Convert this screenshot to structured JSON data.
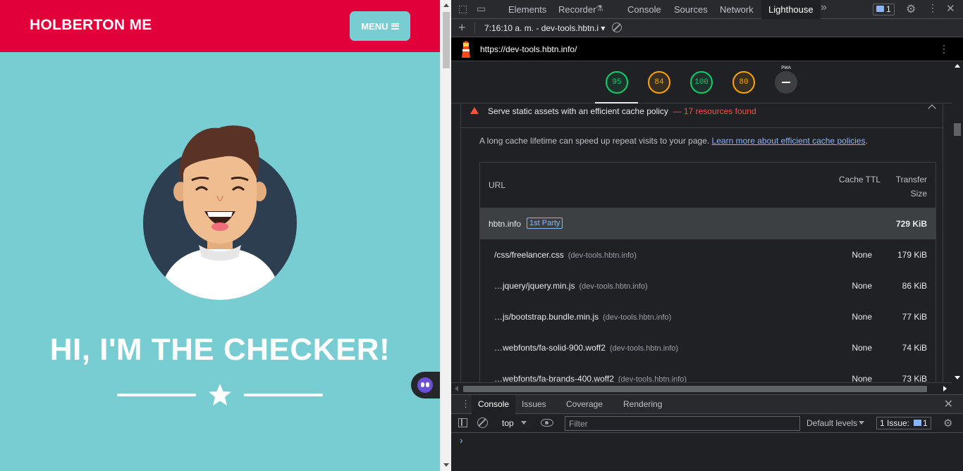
{
  "page": {
    "brand": "HOLBERTON ME",
    "menu_label": "MENU",
    "hero_title": "HI, I'M THE CHECKER!"
  },
  "devtools": {
    "tabs": [
      "Elements",
      "Recorder",
      "Console",
      "Sources",
      "Network",
      "Lighthouse"
    ],
    "active_tab": "Lighthouse",
    "issues_count": "1",
    "report_label": "7:16:10 a. m. - dev-tools.hbtn.i",
    "url": "https://dev-tools.hbtn.info/",
    "scores": [
      "95",
      "84",
      "100",
      "80"
    ],
    "pwa_label": "PWA",
    "audit": {
      "title": "Serve static assets with an efficient cache policy",
      "summary": "— 17 resources found",
      "description": "A long cache lifetime can speed up repeat visits to your page.",
      "link": "Learn more about efficient cache policies",
      "headers": {
        "url": "URL",
        "ttl": "Cache TTL",
        "size": "Transfer Size"
      },
      "group": {
        "name": "hbtn.info",
        "badge": "1st Party",
        "size": "729 KiB"
      },
      "rows": [
        {
          "url": "/css/freelancer.css",
          "host": "(dev-tools.hbtn.info)",
          "ttl": "None",
          "size": "179 KiB"
        },
        {
          "url": "…jquery/jquery.min.js",
          "host": "(dev-tools.hbtn.info)",
          "ttl": "None",
          "size": "86 KiB"
        },
        {
          "url": "…js/bootstrap.bundle.min.js",
          "host": "(dev-tools.hbtn.info)",
          "ttl": "None",
          "size": "77 KiB"
        },
        {
          "url": "…webfonts/fa-solid-900.woff2",
          "host": "(dev-tools.hbtn.info)",
          "ttl": "None",
          "size": "74 KiB"
        },
        {
          "url": "…webfonts/fa-brands-400.woff2",
          "host": "(dev-tools.hbtn.info)",
          "ttl": "None",
          "size": "73 KiB"
        }
      ]
    },
    "drawer_tabs": [
      "Console",
      "Issues",
      "Coverage",
      "Rendering"
    ],
    "console": {
      "context": "top",
      "filter_placeholder": "Filter",
      "levels": "Default levels",
      "issues_label": "1 Issue:",
      "issues_count": "1",
      "prompt": "›"
    }
  }
}
